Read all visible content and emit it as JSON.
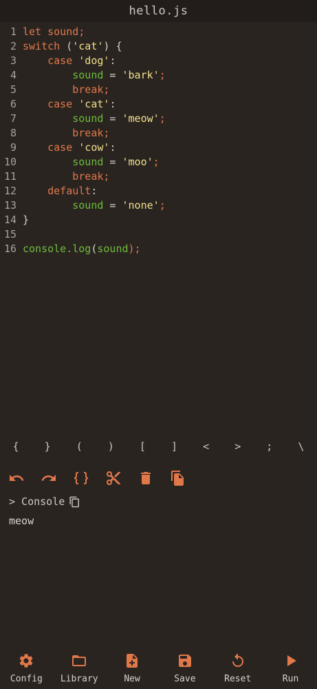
{
  "title": "hello.js",
  "code_lines": [
    {
      "n": "1",
      "tokens": [
        {
          "t": "let sound;",
          "c": "kw"
        }
      ]
    },
    {
      "n": "2",
      "tokens": [
        {
          "t": "switch ",
          "c": "kw"
        },
        {
          "t": "(",
          "c": "pl"
        },
        {
          "t": "'cat'",
          "c": "str"
        },
        {
          "t": ") {",
          "c": "pl"
        }
      ]
    },
    {
      "n": "3",
      "tokens": [
        {
          "t": "    case ",
          "c": "kw"
        },
        {
          "t": "'dog'",
          "c": "str"
        },
        {
          "t": ":",
          "c": "pl"
        }
      ]
    },
    {
      "n": "4",
      "tokens": [
        {
          "t": "        sound",
          "c": "var"
        },
        {
          "t": " = ",
          "c": "pl"
        },
        {
          "t": "'bark'",
          "c": "str"
        },
        {
          "t": ";",
          "c": "kw"
        }
      ]
    },
    {
      "n": "5",
      "tokens": [
        {
          "t": "        break;",
          "c": "kw"
        }
      ]
    },
    {
      "n": "6",
      "tokens": [
        {
          "t": "    case ",
          "c": "kw"
        },
        {
          "t": "'cat'",
          "c": "str"
        },
        {
          "t": ":",
          "c": "pl"
        }
      ]
    },
    {
      "n": "7",
      "tokens": [
        {
          "t": "        sound",
          "c": "var"
        },
        {
          "t": " = ",
          "c": "pl"
        },
        {
          "t": "'meow'",
          "c": "str"
        },
        {
          "t": ";",
          "c": "kw"
        }
      ]
    },
    {
      "n": "8",
      "tokens": [
        {
          "t": "        break;",
          "c": "kw"
        }
      ]
    },
    {
      "n": "9",
      "tokens": [
        {
          "t": "    case ",
          "c": "kw"
        },
        {
          "t": "'cow'",
          "c": "str"
        },
        {
          "t": ":",
          "c": "pl"
        }
      ]
    },
    {
      "n": "10",
      "tokens": [
        {
          "t": "        sound",
          "c": "var"
        },
        {
          "t": " = ",
          "c": "pl"
        },
        {
          "t": "'moo'",
          "c": "str"
        },
        {
          "t": ";",
          "c": "kw"
        }
      ]
    },
    {
      "n": "11",
      "tokens": [
        {
          "t": "        break;",
          "c": "kw"
        }
      ]
    },
    {
      "n": "12",
      "tokens": [
        {
          "t": "    default",
          "c": "kw"
        },
        {
          "t": ":",
          "c": "pl"
        }
      ]
    },
    {
      "n": "13",
      "tokens": [
        {
          "t": "        sound",
          "c": "var"
        },
        {
          "t": " = ",
          "c": "pl"
        },
        {
          "t": "'none'",
          "c": "str"
        },
        {
          "t": ";",
          "c": "kw"
        }
      ]
    },
    {
      "n": "14",
      "tokens": [
        {
          "t": "}",
          "c": "pl"
        }
      ]
    },
    {
      "n": "15",
      "tokens": []
    },
    {
      "n": "16",
      "tokens": [
        {
          "t": "console.log",
          "c": "var"
        },
        {
          "t": "(",
          "c": "pl"
        },
        {
          "t": "sound",
          "c": "var"
        },
        {
          "t": ");",
          "c": "kw"
        }
      ]
    }
  ],
  "symbols": [
    "{",
    "}",
    "(",
    ")",
    "[",
    "]",
    "<",
    ">",
    ";",
    "\\"
  ],
  "toolbar": [
    {
      "name": "undo-icon"
    },
    {
      "name": "redo-icon"
    },
    {
      "name": "format-braces-icon"
    },
    {
      "name": "scissors-icon"
    },
    {
      "name": "trash-icon"
    },
    {
      "name": "copy-file-icon"
    }
  ],
  "console": {
    "label": "> Console",
    "output": "meow"
  },
  "bottom_nav": [
    {
      "label": "Config",
      "icon": "gear-icon"
    },
    {
      "label": "Library",
      "icon": "folder-icon"
    },
    {
      "label": "New",
      "icon": "new-file-icon"
    },
    {
      "label": "Save",
      "icon": "save-icon"
    },
    {
      "label": "Reset",
      "icon": "reset-icon"
    },
    {
      "label": "Run",
      "icon": "play-icon"
    }
  ],
  "colors": {
    "accent": "#e0784a",
    "background": "#2a2421",
    "keyword": "#e0784a",
    "variable": "#6ebc3c",
    "string": "#f0e08a"
  }
}
